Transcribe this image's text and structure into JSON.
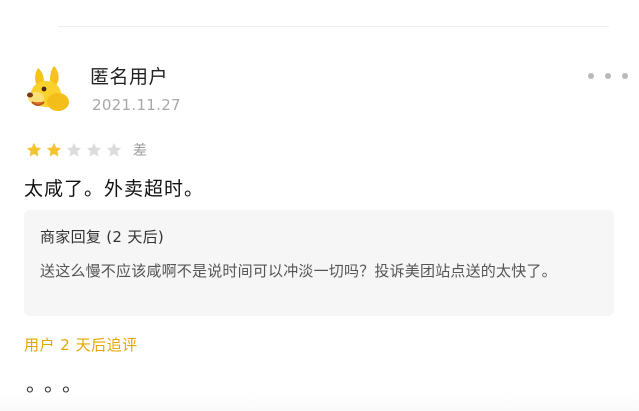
{
  "review": {
    "user": {
      "name": "匿名用户",
      "date": "2021.11.27"
    },
    "rating": {
      "stars_filled": 2,
      "stars_total": 5,
      "label": "差",
      "filled_color": "#F5C332",
      "empty_color": "#DCDCDC"
    },
    "text": "太咸了。外卖超时。",
    "merchant_reply": {
      "title": "商家回复 (2 天后)",
      "body": "送这么慢不应该咸啊不是说时间可以冲淡一切吗？投诉美团站点送的太快了。"
    },
    "followup": {
      "label": "用户 2 天后追评",
      "text": "。。。"
    },
    "icons": {
      "avatar": "yellow-dog-avatar-icon",
      "more": "more-dots-icon",
      "star": "star-icon"
    }
  },
  "colors": {
    "accent": "#E3A600",
    "reply_background": "#F6F6F6"
  }
}
